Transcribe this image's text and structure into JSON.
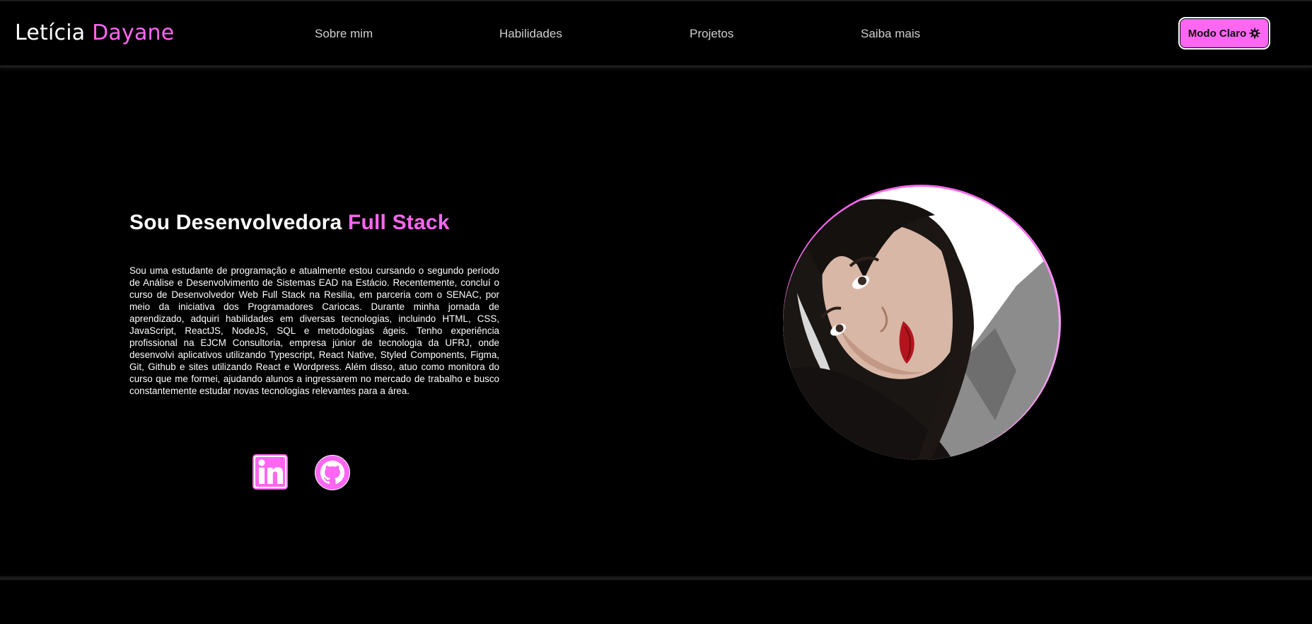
{
  "header": {
    "logo_first": "Letícia",
    "logo_last": "Dayane",
    "nav": [
      {
        "label": "Sobre mim"
      },
      {
        "label": "Habilidades"
      },
      {
        "label": "Projetos"
      },
      {
        "label": "Saiba mais"
      }
    ],
    "theme_button_label": "Modo Claro",
    "theme_button_icon": "gear-icon"
  },
  "hero": {
    "title_prefix": "Sou Desenvolvedora",
    "title_accent": "Full Stack",
    "bio": "Sou uma estudante de programação e atualmente estou cursando o segundo período de Análise e Desenvolvimento de Sistemas EAD na Estácio. Recentemente, concluí o curso de Desenvolvedor Web Full Stack na Resilia, em parceria com o SENAC, por meio da iniciativa dos Programadores Cariocas. Durante minha jornada de aprendizado, adquiri habilidades em diversas tecnologias, incluindo HTML, CSS, JavaScript, ReactJS, NodeJS, SQL e metodologias ágeis. Tenho experiência profissional na EJCM Consultoria, empresa júnior de tecnologia da UFRJ, onde desenvolvi aplicativos utilizando Typescript, React Native, Styled Components, Figma, Git, Github e sites utilizando React e Wordpress. Além disso, atuo como monitora do curso que me formei, ajudando alunos a ingressarem no mercado de trabalho e busco constantemente estudar novas tecnologias relevantes para a área.",
    "social": [
      {
        "icon": "linkedin-icon"
      },
      {
        "icon": "github-icon"
      }
    ],
    "photo": "profile-photo"
  },
  "colors": {
    "background": "#000000",
    "accent": "#ff66f2",
    "text": "#ffffff",
    "nav_text": "#cfcfcf"
  }
}
